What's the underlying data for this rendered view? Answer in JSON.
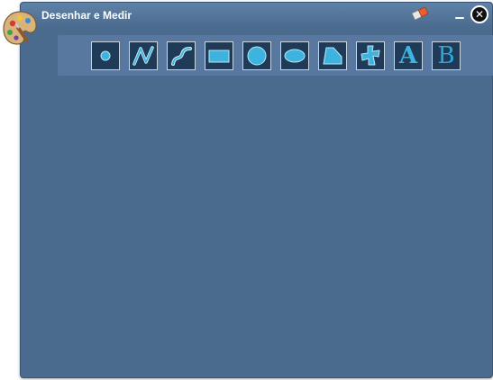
{
  "window": {
    "title": "Desenhar e Medir",
    "icons": {
      "app": "palette-icon",
      "eraser": "eraser-icon",
      "minimize": "minimize-icon",
      "close": "close-icon"
    }
  },
  "toolbar": {
    "tools": [
      {
        "id": "point",
        "icon": "point-icon"
      },
      {
        "id": "polyline",
        "icon": "polyline-icon"
      },
      {
        "id": "curve",
        "icon": "curve-icon"
      },
      {
        "id": "rectangle",
        "icon": "rectangle-icon"
      },
      {
        "id": "circle",
        "icon": "circle-icon"
      },
      {
        "id": "ellipse",
        "icon": "ellipse-icon"
      },
      {
        "id": "polygon",
        "icon": "polygon-icon"
      },
      {
        "id": "freeform",
        "icon": "freeform-shape-icon"
      },
      {
        "id": "text-serif",
        "icon": "text-icon",
        "label": "A"
      },
      {
        "id": "text-alt",
        "icon": "text-icon",
        "label": "B"
      }
    ]
  },
  "colors": {
    "panel": "#4a6b8e",
    "toolbar": "#5878a0",
    "tool_bg": "#1f3b57",
    "accent": "#2fa8d8"
  }
}
